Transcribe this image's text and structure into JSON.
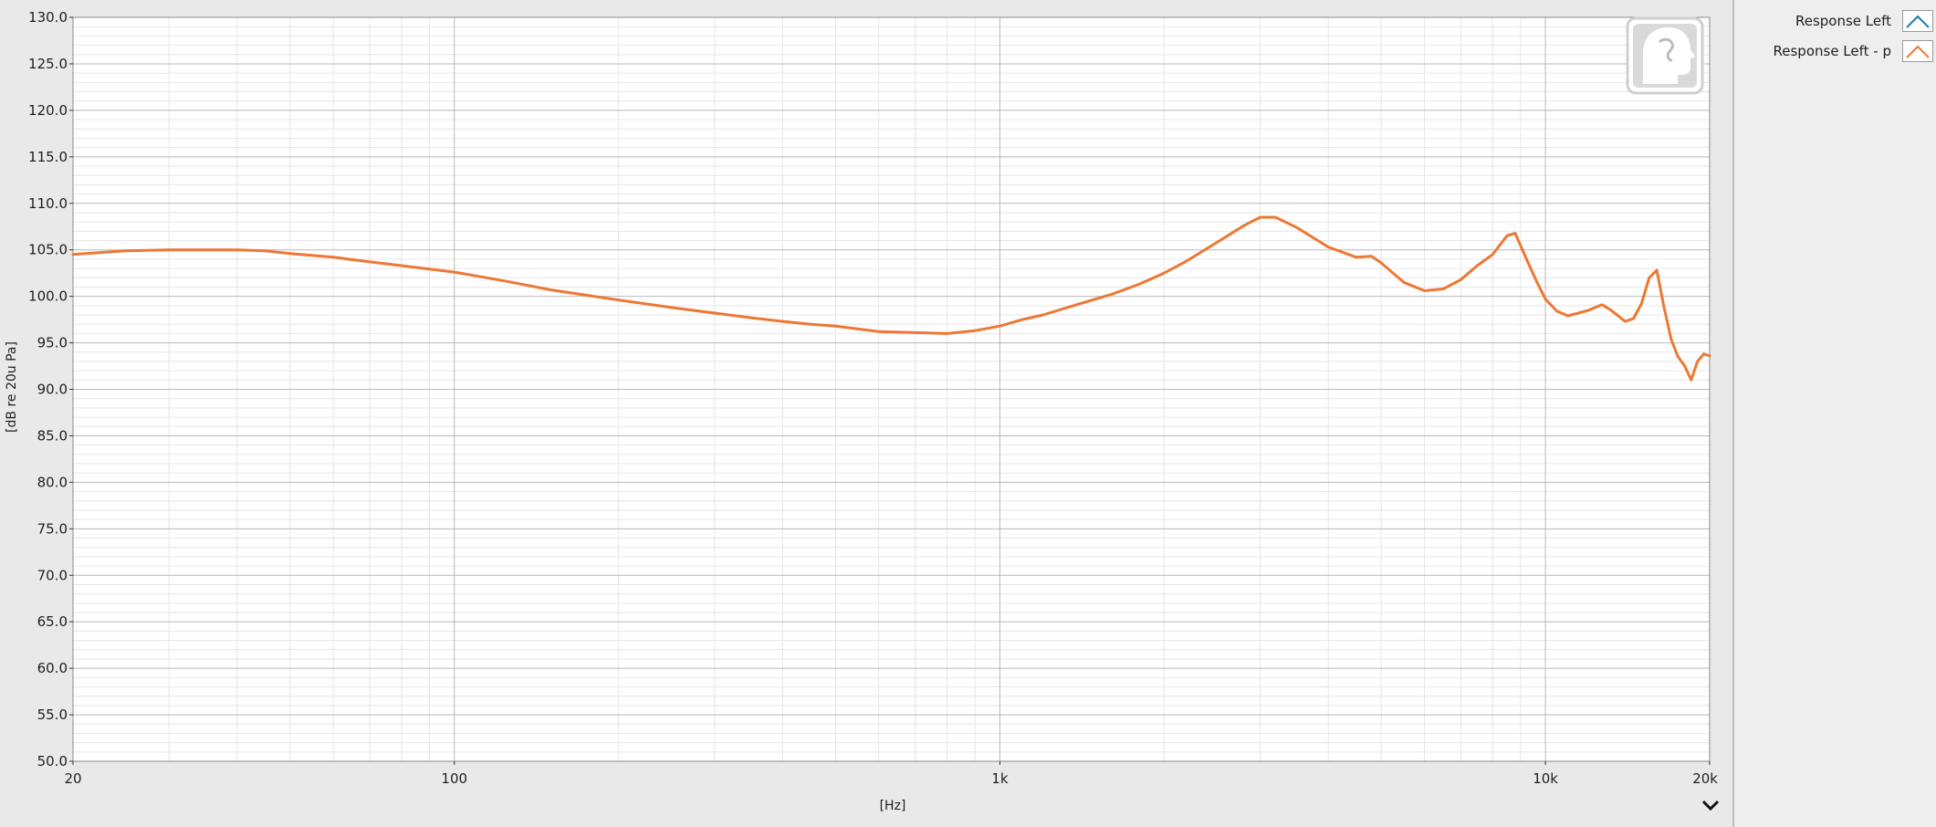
{
  "chart_data": {
    "type": "line",
    "xscale": "log",
    "xlim": [
      20,
      20000
    ],
    "ylim": [
      50,
      130
    ],
    "xlabel": "[Hz]",
    "ylabel": "[dB re 20u Pa]",
    "grid": true,
    "legend_position": "right-panel",
    "y_ticks": [
      50,
      55,
      60,
      65,
      70,
      75,
      80,
      85,
      90,
      95,
      100,
      105,
      110,
      115,
      120,
      125,
      130
    ],
    "y_tick_labels": [
      "50.0",
      "55.0",
      "60.0",
      "65.0",
      "70.0",
      "75.0",
      "80.0",
      "85.0",
      "90.0",
      "95.0",
      "100.0",
      "105.0",
      "110.0",
      "115.0",
      "120.0",
      "125.0",
      "130.0"
    ],
    "x_ticks": [
      20,
      100,
      1000,
      10000,
      20000
    ],
    "x_tick_labels": [
      "20",
      "100",
      "1k",
      "10k",
      "20k"
    ],
    "series": [
      {
        "name": "Response Left",
        "color": "#1f77b4",
        "visible": false,
        "x": [],
        "y": []
      },
      {
        "name": "Response Left - p",
        "color": "#ee7733",
        "visible": true,
        "x": [
          20,
          25,
          30,
          35,
          40,
          45,
          50,
          60,
          70,
          80,
          100,
          125,
          150,
          200,
          250,
          300,
          350,
          400,
          450,
          500,
          600,
          700,
          800,
          900,
          1000,
          1100,
          1200,
          1400,
          1600,
          1800,
          2000,
          2200,
          2500,
          2800,
          3000,
          3200,
          3500,
          4000,
          4500,
          4800,
          5000,
          5500,
          6000,
          6500,
          7000,
          7500,
          8000,
          8500,
          8800,
          9000,
          9300,
          9600,
          10000,
          10500,
          11000,
          12000,
          12700,
          13200,
          14000,
          14500,
          15000,
          15500,
          16000,
          16500,
          17000,
          17500,
          18000,
          18500,
          19000,
          19500,
          20000
        ],
        "y": [
          104.5,
          104.9,
          105.0,
          105.0,
          105.0,
          104.9,
          104.6,
          104.2,
          103.7,
          103.3,
          102.6,
          101.6,
          100.7,
          99.6,
          98.8,
          98.2,
          97.7,
          97.3,
          97.0,
          96.8,
          96.2,
          96.1,
          96.0,
          96.3,
          96.8,
          97.5,
          98.0,
          99.2,
          100.2,
          101.3,
          102.5,
          103.8,
          105.8,
          107.6,
          108.5,
          108.5,
          107.4,
          105.3,
          104.2,
          104.3,
          103.6,
          101.5,
          100.6,
          100.8,
          101.8,
          103.3,
          104.5,
          106.5,
          106.8,
          105.5,
          103.6,
          101.8,
          99.7,
          98.4,
          97.9,
          98.5,
          99.1,
          98.5,
          97.3,
          97.6,
          99.2,
          102.0,
          102.8,
          98.8,
          95.4,
          93.5,
          92.5,
          91.0,
          93.0,
          93.8,
          93.6
        ]
      }
    ]
  },
  "legend": {
    "items": [
      {
        "label": "Response Left",
        "color": "#1f77b4"
      },
      {
        "label": "Response Left - p",
        "color": "#ee7733"
      }
    ]
  },
  "icons": {
    "watermark": "head-profile-icon",
    "expand": "chevron-down-icon"
  },
  "colors": {
    "plot_background": "#ffffff",
    "grid_major": "#b8b8b8",
    "grid_minor": "#e6e6e6",
    "accent": "#ee7733"
  }
}
